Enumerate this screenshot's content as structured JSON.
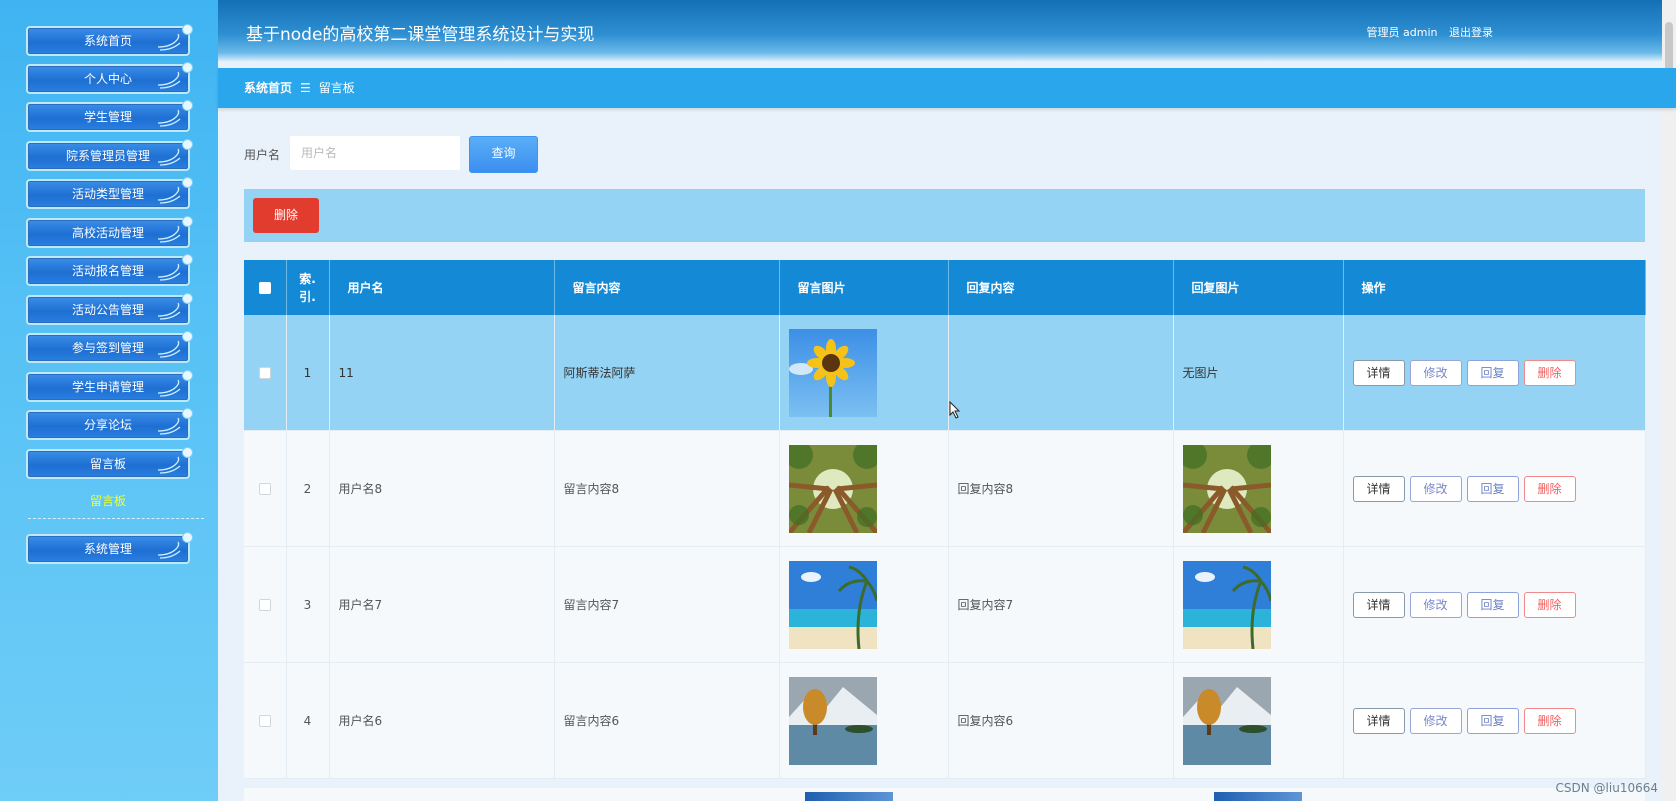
{
  "header": {
    "title": "基于node的高校第二课堂管理系统设计与实现",
    "user_label": "管理员 admin",
    "logout_label": "退出登录"
  },
  "sidebar": {
    "items": [
      {
        "label": "系统首页"
      },
      {
        "label": "个人中心"
      },
      {
        "label": "学生管理"
      },
      {
        "label": "院系管理员管理"
      },
      {
        "label": "活动类型管理"
      },
      {
        "label": "高校活动管理"
      },
      {
        "label": "活动报名管理"
      },
      {
        "label": "活动公告管理"
      },
      {
        "label": "参与签到管理"
      },
      {
        "label": "学生申请管理"
      },
      {
        "label": "分享论坛"
      },
      {
        "label": "留言板"
      }
    ],
    "active_sub_item": "留言板",
    "bottom_item": {
      "label": "系统管理"
    }
  },
  "breadcrumb": {
    "home": "系统首页",
    "separator": "☰",
    "current": "留言板"
  },
  "search": {
    "label": "用户名",
    "placeholder": "用户名",
    "value": "",
    "button_label": "查询"
  },
  "actions": {
    "delete_label": "删除"
  },
  "table": {
    "columns": {
      "index_line1": "索.",
      "index_line2": "引.",
      "username": "用户名",
      "content": "留言内容",
      "image": "留言图片",
      "reply": "回复内容",
      "reply_image": "回复图片",
      "ops": "操作"
    },
    "rows": [
      {
        "index": "1",
        "username": "11",
        "content": "阿斯蒂法阿萨",
        "image": "sunflower",
        "reply": "",
        "reply_image_text": "无图片",
        "reply_image": ""
      },
      {
        "index": "2",
        "username": "用户名8",
        "content": "留言内容8",
        "image": "forest",
        "reply": "回复内容8",
        "reply_image": "forest",
        "reply_image_text": ""
      },
      {
        "index": "3",
        "username": "用户名7",
        "content": "留言内容7",
        "image": "beach",
        "reply": "回复内容7",
        "reply_image": "beach",
        "reply_image_text": ""
      },
      {
        "index": "4",
        "username": "用户名6",
        "content": "留言内容6",
        "image": "lake",
        "reply": "回复内容6",
        "reply_image": "lake",
        "reply_image_text": ""
      }
    ],
    "op_labels": {
      "detail": "详情",
      "edit": "修改",
      "reply": "回复",
      "delete": "删除"
    }
  },
  "watermark": "CSDN @liu10664",
  "colors": {
    "sidebar": "#3fb4f2",
    "header": "#1470b4",
    "breadcrumb": "#2aa7ec",
    "table_header": "#148ad6",
    "highlight_row": "#94d3f3",
    "delete_button": "#e23c2f",
    "search_button": "#3b8ff0"
  }
}
